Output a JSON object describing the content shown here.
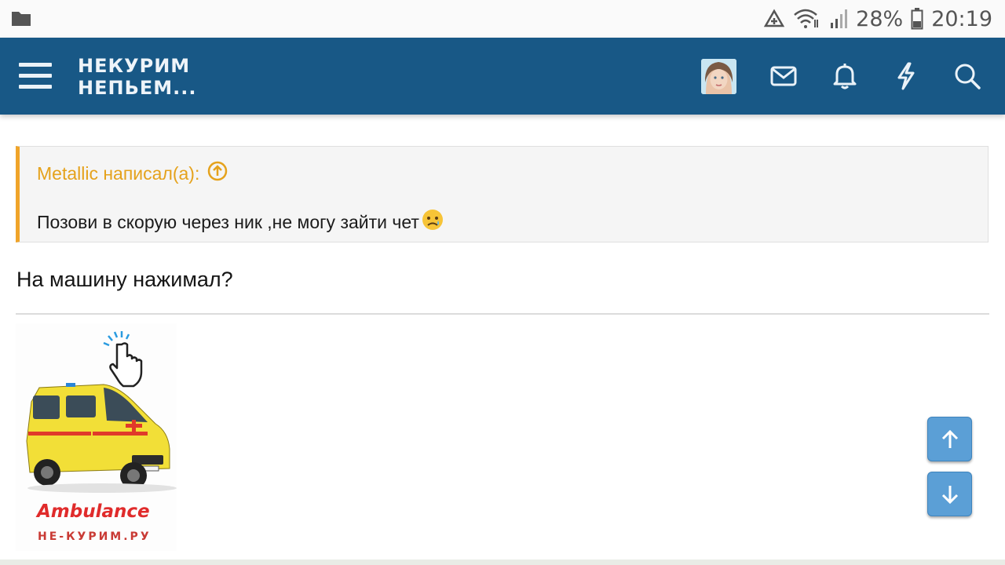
{
  "status_bar": {
    "battery_percent": "28%",
    "time": "20:19",
    "icons": [
      "folder-icon",
      "data-saver-icon",
      "wifi-icon",
      "signal-icon",
      "battery-icon"
    ]
  },
  "header": {
    "logo_line1": "НЕКУРИМ",
    "logo_line2": "НЕПЬЕМ...",
    "icons": [
      "menu-icon",
      "avatar",
      "mail-icon",
      "bell-icon",
      "lightning-icon",
      "search-icon"
    ],
    "background_color": "#185886"
  },
  "quote": {
    "title": "Metallic написал(а):",
    "text": "Позови в скорую через ник ,не могу зайти чет",
    "emoji": "😥",
    "accent_color": "#f0a429"
  },
  "post": {
    "text": "На машину нажимал?"
  },
  "ambulance_image": {
    "label": "Ambulance",
    "sublabel": "НЕ-КУРИМ.РУ"
  },
  "scroll_buttons": {
    "up_icon": "arrow-up-icon",
    "down_icon": "arrow-down-icon"
  }
}
